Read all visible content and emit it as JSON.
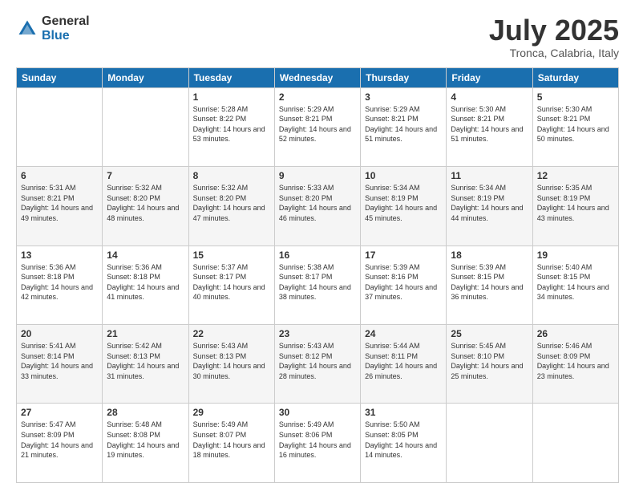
{
  "header": {
    "logo_general": "General",
    "logo_blue": "Blue",
    "month_year": "July 2025",
    "location": "Tronca, Calabria, Italy"
  },
  "weekdays": [
    "Sunday",
    "Monday",
    "Tuesday",
    "Wednesday",
    "Thursday",
    "Friday",
    "Saturday"
  ],
  "weeks": [
    [
      {
        "day": "",
        "sunrise": "",
        "sunset": "",
        "daylight": ""
      },
      {
        "day": "",
        "sunrise": "",
        "sunset": "",
        "daylight": ""
      },
      {
        "day": "1",
        "sunrise": "Sunrise: 5:28 AM",
        "sunset": "Sunset: 8:22 PM",
        "daylight": "Daylight: 14 hours and 53 minutes."
      },
      {
        "day": "2",
        "sunrise": "Sunrise: 5:29 AM",
        "sunset": "Sunset: 8:21 PM",
        "daylight": "Daylight: 14 hours and 52 minutes."
      },
      {
        "day": "3",
        "sunrise": "Sunrise: 5:29 AM",
        "sunset": "Sunset: 8:21 PM",
        "daylight": "Daylight: 14 hours and 51 minutes."
      },
      {
        "day": "4",
        "sunrise": "Sunrise: 5:30 AM",
        "sunset": "Sunset: 8:21 PM",
        "daylight": "Daylight: 14 hours and 51 minutes."
      },
      {
        "day": "5",
        "sunrise": "Sunrise: 5:30 AM",
        "sunset": "Sunset: 8:21 PM",
        "daylight": "Daylight: 14 hours and 50 minutes."
      }
    ],
    [
      {
        "day": "6",
        "sunrise": "Sunrise: 5:31 AM",
        "sunset": "Sunset: 8:21 PM",
        "daylight": "Daylight: 14 hours and 49 minutes."
      },
      {
        "day": "7",
        "sunrise": "Sunrise: 5:32 AM",
        "sunset": "Sunset: 8:20 PM",
        "daylight": "Daylight: 14 hours and 48 minutes."
      },
      {
        "day": "8",
        "sunrise": "Sunrise: 5:32 AM",
        "sunset": "Sunset: 8:20 PM",
        "daylight": "Daylight: 14 hours and 47 minutes."
      },
      {
        "day": "9",
        "sunrise": "Sunrise: 5:33 AM",
        "sunset": "Sunset: 8:20 PM",
        "daylight": "Daylight: 14 hours and 46 minutes."
      },
      {
        "day": "10",
        "sunrise": "Sunrise: 5:34 AM",
        "sunset": "Sunset: 8:19 PM",
        "daylight": "Daylight: 14 hours and 45 minutes."
      },
      {
        "day": "11",
        "sunrise": "Sunrise: 5:34 AM",
        "sunset": "Sunset: 8:19 PM",
        "daylight": "Daylight: 14 hours and 44 minutes."
      },
      {
        "day": "12",
        "sunrise": "Sunrise: 5:35 AM",
        "sunset": "Sunset: 8:19 PM",
        "daylight": "Daylight: 14 hours and 43 minutes."
      }
    ],
    [
      {
        "day": "13",
        "sunrise": "Sunrise: 5:36 AM",
        "sunset": "Sunset: 8:18 PM",
        "daylight": "Daylight: 14 hours and 42 minutes."
      },
      {
        "day": "14",
        "sunrise": "Sunrise: 5:36 AM",
        "sunset": "Sunset: 8:18 PM",
        "daylight": "Daylight: 14 hours and 41 minutes."
      },
      {
        "day": "15",
        "sunrise": "Sunrise: 5:37 AM",
        "sunset": "Sunset: 8:17 PM",
        "daylight": "Daylight: 14 hours and 40 minutes."
      },
      {
        "day": "16",
        "sunrise": "Sunrise: 5:38 AM",
        "sunset": "Sunset: 8:17 PM",
        "daylight": "Daylight: 14 hours and 38 minutes."
      },
      {
        "day": "17",
        "sunrise": "Sunrise: 5:39 AM",
        "sunset": "Sunset: 8:16 PM",
        "daylight": "Daylight: 14 hours and 37 minutes."
      },
      {
        "day": "18",
        "sunrise": "Sunrise: 5:39 AM",
        "sunset": "Sunset: 8:15 PM",
        "daylight": "Daylight: 14 hours and 36 minutes."
      },
      {
        "day": "19",
        "sunrise": "Sunrise: 5:40 AM",
        "sunset": "Sunset: 8:15 PM",
        "daylight": "Daylight: 14 hours and 34 minutes."
      }
    ],
    [
      {
        "day": "20",
        "sunrise": "Sunrise: 5:41 AM",
        "sunset": "Sunset: 8:14 PM",
        "daylight": "Daylight: 14 hours and 33 minutes."
      },
      {
        "day": "21",
        "sunrise": "Sunrise: 5:42 AM",
        "sunset": "Sunset: 8:13 PM",
        "daylight": "Daylight: 14 hours and 31 minutes."
      },
      {
        "day": "22",
        "sunrise": "Sunrise: 5:43 AM",
        "sunset": "Sunset: 8:13 PM",
        "daylight": "Daylight: 14 hours and 30 minutes."
      },
      {
        "day": "23",
        "sunrise": "Sunrise: 5:43 AM",
        "sunset": "Sunset: 8:12 PM",
        "daylight": "Daylight: 14 hours and 28 minutes."
      },
      {
        "day": "24",
        "sunrise": "Sunrise: 5:44 AM",
        "sunset": "Sunset: 8:11 PM",
        "daylight": "Daylight: 14 hours and 26 minutes."
      },
      {
        "day": "25",
        "sunrise": "Sunrise: 5:45 AM",
        "sunset": "Sunset: 8:10 PM",
        "daylight": "Daylight: 14 hours and 25 minutes."
      },
      {
        "day": "26",
        "sunrise": "Sunrise: 5:46 AM",
        "sunset": "Sunset: 8:09 PM",
        "daylight": "Daylight: 14 hours and 23 minutes."
      }
    ],
    [
      {
        "day": "27",
        "sunrise": "Sunrise: 5:47 AM",
        "sunset": "Sunset: 8:09 PM",
        "daylight": "Daylight: 14 hours and 21 minutes."
      },
      {
        "day": "28",
        "sunrise": "Sunrise: 5:48 AM",
        "sunset": "Sunset: 8:08 PM",
        "daylight": "Daylight: 14 hours and 19 minutes."
      },
      {
        "day": "29",
        "sunrise": "Sunrise: 5:49 AM",
        "sunset": "Sunset: 8:07 PM",
        "daylight": "Daylight: 14 hours and 18 minutes."
      },
      {
        "day": "30",
        "sunrise": "Sunrise: 5:49 AM",
        "sunset": "Sunset: 8:06 PM",
        "daylight": "Daylight: 14 hours and 16 minutes."
      },
      {
        "day": "31",
        "sunrise": "Sunrise: 5:50 AM",
        "sunset": "Sunset: 8:05 PM",
        "daylight": "Daylight: 14 hours and 14 minutes."
      },
      {
        "day": "",
        "sunrise": "",
        "sunset": "",
        "daylight": ""
      },
      {
        "day": "",
        "sunrise": "",
        "sunset": "",
        "daylight": ""
      }
    ]
  ]
}
